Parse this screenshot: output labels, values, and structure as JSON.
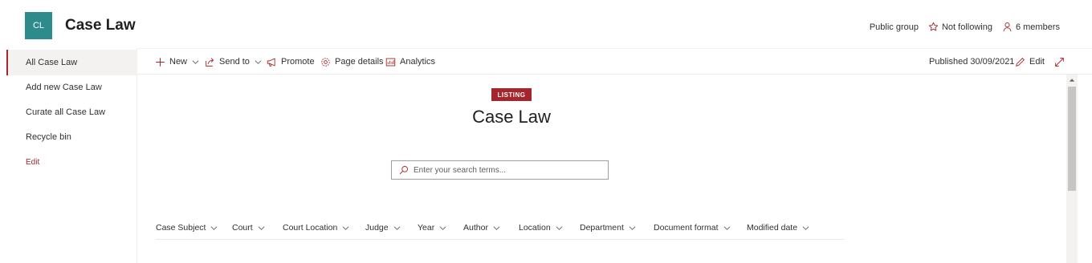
{
  "site": {
    "logo_initials": "CL",
    "title": "Case Law",
    "logo_color": "#2e8b8b"
  },
  "header": {
    "group_type": "Public group",
    "follow_label": "Not following",
    "members_label": "6 members"
  },
  "nav": {
    "items": [
      {
        "label": "All Case Law",
        "selected": true
      },
      {
        "label": "Add new Case Law",
        "selected": false
      },
      {
        "label": "Curate all Case Law",
        "selected": false
      },
      {
        "label": "Recycle bin",
        "selected": false
      }
    ],
    "edit_label": "Edit"
  },
  "command_bar": {
    "new_label": "New",
    "send_to_label": "Send to",
    "promote_label": "Promote",
    "page_details_label": "Page details",
    "analytics_label": "Analytics",
    "published_label": "Published 30/09/2021",
    "edit_label": "Edit"
  },
  "content": {
    "badge": "LISTING",
    "title": "Case Law",
    "search_placeholder": "Enter your search terms...",
    "search_value": ""
  },
  "refiners": [
    "Case Subject",
    "Court",
    "Court Location",
    "Judge",
    "Year",
    "Author",
    "Location",
    "Department",
    "Document format",
    "Modified date"
  ],
  "colors": {
    "accent": "#a4262c",
    "nav_selected_bg": "#f3f2f1"
  },
  "icons": {
    "follow": "star-icon",
    "members": "person-icon",
    "new": "plus-icon",
    "send_to": "share-icon",
    "promote": "megaphone-icon",
    "page_details": "gear-icon",
    "analytics": "chart-icon",
    "edit": "pencil-icon",
    "expand": "expand-icon",
    "search": "search-icon"
  }
}
